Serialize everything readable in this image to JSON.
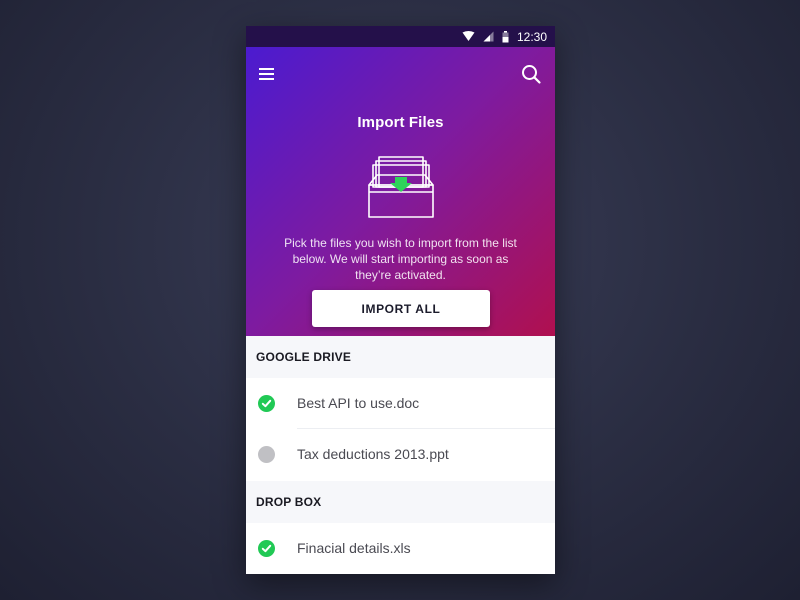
{
  "status_bar": {
    "time": "12:30"
  },
  "header": {
    "title": "Import Files",
    "description": "Pick the files you wish to import from the list below. We will start importing as soon as they’re activated.",
    "import_all_label": "IMPORT ALL"
  },
  "icons": {
    "menu": "hamburger-menu-icon",
    "search": "search-icon",
    "illustration": "inbox-download-icon",
    "done": "check-icon",
    "pending": "pending-dot-icon"
  },
  "colors": {
    "gradient_start": "#4b1bd0",
    "gradient_mid": "#7e1ba0",
    "gradient_end": "#b0104f",
    "status_done": "#21c955",
    "status_pending": "#c0c0c4",
    "arrow_green": "#2fd35a"
  },
  "sections": [
    {
      "title": "GOOGLE DRIVE",
      "files": [
        {
          "name": "Best API to use.doc",
          "status": "done"
        },
        {
          "name": "Tax deductions 2013.ppt",
          "status": "pending"
        }
      ]
    },
    {
      "title": "DROP BOX",
      "files": [
        {
          "name": "Finacial details.xls",
          "status": "done"
        }
      ]
    }
  ]
}
